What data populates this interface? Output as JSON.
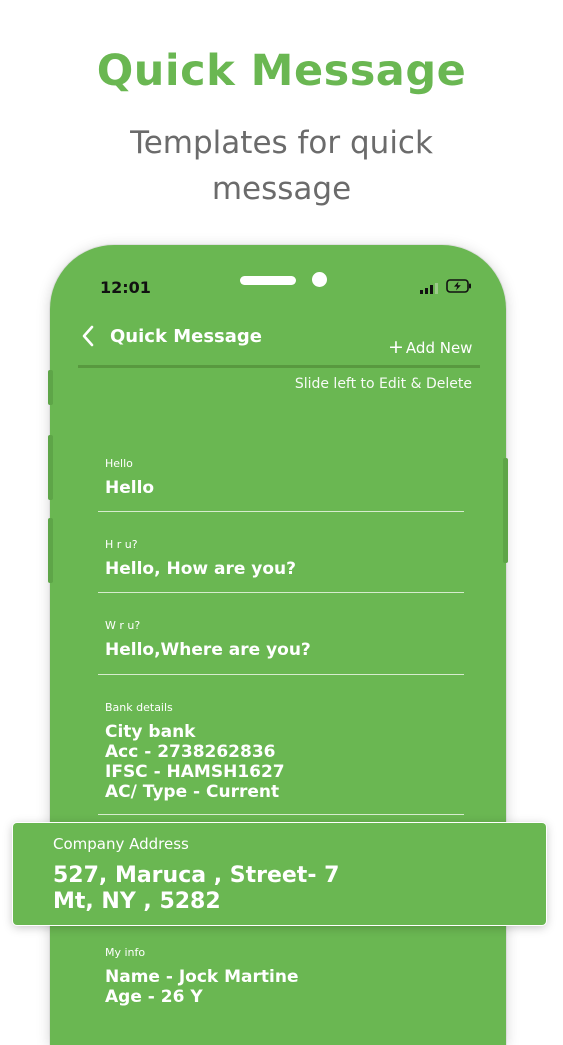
{
  "promo": {
    "title": "Quick Message",
    "subtitle": "Templates for quick message"
  },
  "status_bar": {
    "time": "12:01",
    "icons": [
      "signal-icon",
      "battery-charging-icon"
    ]
  },
  "nav": {
    "back_icon": "chevron-left-icon",
    "title": "Quick Message",
    "add_label": "Add New",
    "add_icon": "plus-icon"
  },
  "hint": "Slide left to Edit & Delete",
  "messages": [
    {
      "label": "Hello",
      "text": "Hello"
    },
    {
      "label": "H r u?",
      "text": "Hello, How are you?"
    },
    {
      "label": "W r u?",
      "text": "Hello,Where are you?"
    },
    {
      "label": "Bank details",
      "text": "City bank\nAcc - 2738262836\nIFSC - HAMSH1627\nAC/ Type - Current"
    },
    {
      "label": "Company Address",
      "text": "527, Maruca , Street- 7\nMt, NY , 5282"
    },
    {
      "label": "My info",
      "text": "Name - Jock Martine\nAge - 26 Y"
    }
  ],
  "colors": {
    "brand_green": "#6ab752",
    "subtitle_gray": "#6b6b6b",
    "text_white": "#ffffff"
  }
}
